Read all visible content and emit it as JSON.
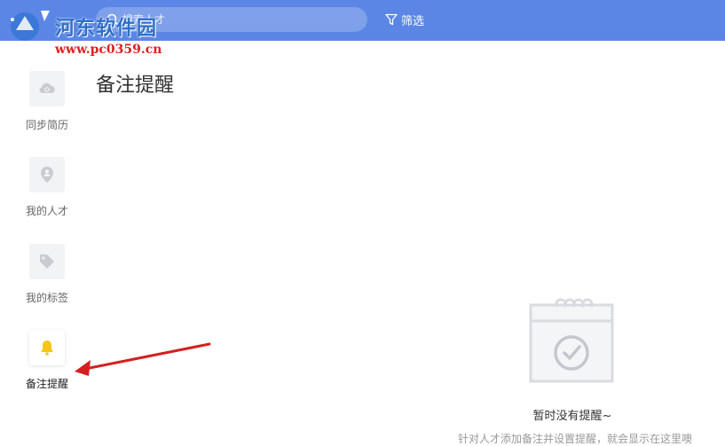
{
  "header": {
    "search_placeholder": "搜索人才",
    "filter_label": "筛选",
    "accent_color": "#5b86e5"
  },
  "watermark": {
    "site_name": "河东软件园",
    "url": "www.pc0359.cn"
  },
  "sidebar": {
    "items": [
      {
        "label": "同步简历",
        "icon": "cloud-sync-icon"
      },
      {
        "label": "我的人才",
        "icon": "person-pin-icon"
      },
      {
        "label": "我的标签",
        "icon": "tag-icon"
      },
      {
        "label": "备注提醒",
        "icon": "bell-icon",
        "active": true
      }
    ]
  },
  "main": {
    "title": "备注提醒",
    "empty_title": "暂时没有提醒~",
    "empty_description": "针对人才添加备注并设置提醒，就会显示在这里噢"
  }
}
